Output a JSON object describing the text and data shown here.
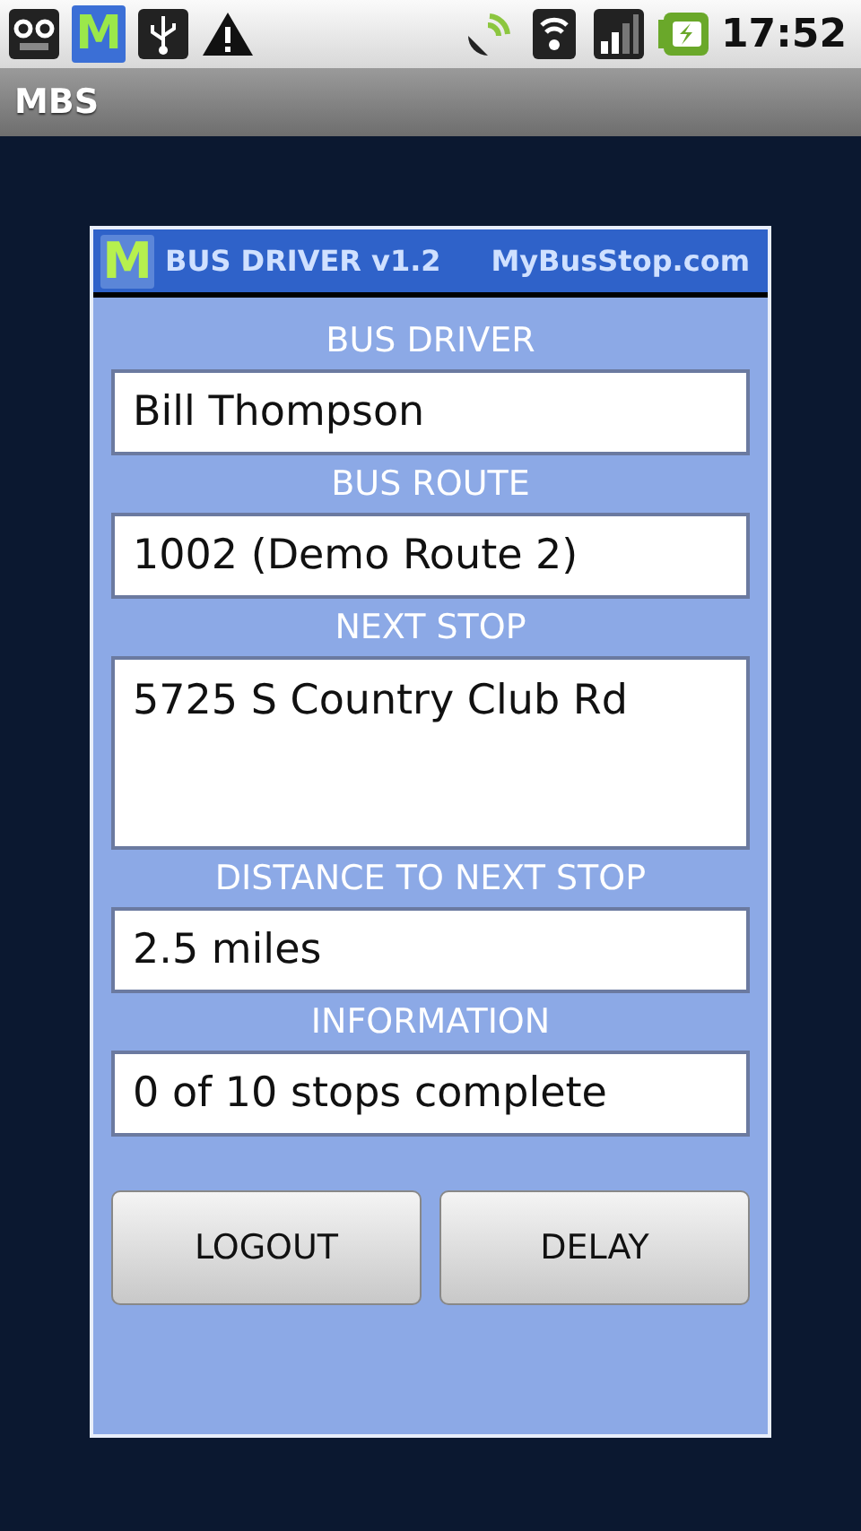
{
  "status_bar": {
    "app_badge": "M",
    "time": "17:52"
  },
  "title_bar": {
    "title": "MBS"
  },
  "card": {
    "logo": "M",
    "title": "BUS DRIVER v1.2",
    "site": "MyBusStop.com",
    "fields": [
      {
        "label": "BUS DRIVER",
        "value": "Bill Thompson",
        "kind": "single"
      },
      {
        "label": "BUS ROUTE",
        "value": "1002 (Demo Route 2)",
        "kind": "single"
      },
      {
        "label": "NEXT STOP",
        "value": "5725 S Country Club Rd",
        "kind": "multiline"
      },
      {
        "label": "DISTANCE TO NEXT STOP",
        "value": "2.5 miles",
        "kind": "single"
      },
      {
        "label": "INFORMATION",
        "value": "0 of 10 stops complete",
        "kind": "single"
      }
    ],
    "buttons": [
      "LOGOUT",
      "DELAY"
    ]
  }
}
